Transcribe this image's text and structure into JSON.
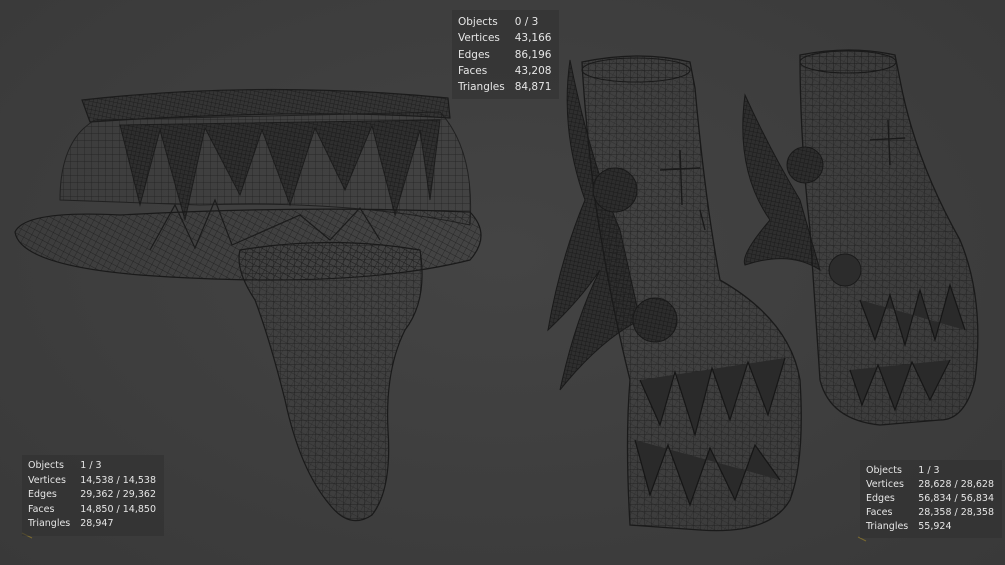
{
  "overlays": {
    "top": {
      "rows": [
        {
          "label": "Objects",
          "value": "0 / 3"
        },
        {
          "label": "Vertices",
          "value": "43,166"
        },
        {
          "label": "Edges",
          "value": "86,196"
        },
        {
          "label": "Faces",
          "value": "43,208"
        },
        {
          "label": "Triangles",
          "value": "84,871"
        }
      ]
    },
    "bottom_left": {
      "rows": [
        {
          "label": "Objects",
          "value": "1 / 3"
        },
        {
          "label": "Vertices",
          "value": "14,538 / 14,538"
        },
        {
          "label": "Edges",
          "value": "29,362 / 29,362"
        },
        {
          "label": "Faces",
          "value": "14,850 / 14,850"
        },
        {
          "label": "Triangles",
          "value": "28,947"
        }
      ]
    },
    "bottom_right": {
      "rows": [
        {
          "label": "Objects",
          "value": "1 / 3"
        },
        {
          "label": "Vertices",
          "value": "28,628 / 28,628"
        },
        {
          "label": "Edges",
          "value": "56,834 / 56,834"
        },
        {
          "label": "Faces",
          "value": "28,358 / 28,358"
        },
        {
          "label": "Triangles",
          "value": "55,924"
        }
      ]
    }
  },
  "colors": {
    "viewport_bg": "#3c3c3c",
    "wire": "#1a1a1a",
    "text": "#e6e6e6"
  }
}
